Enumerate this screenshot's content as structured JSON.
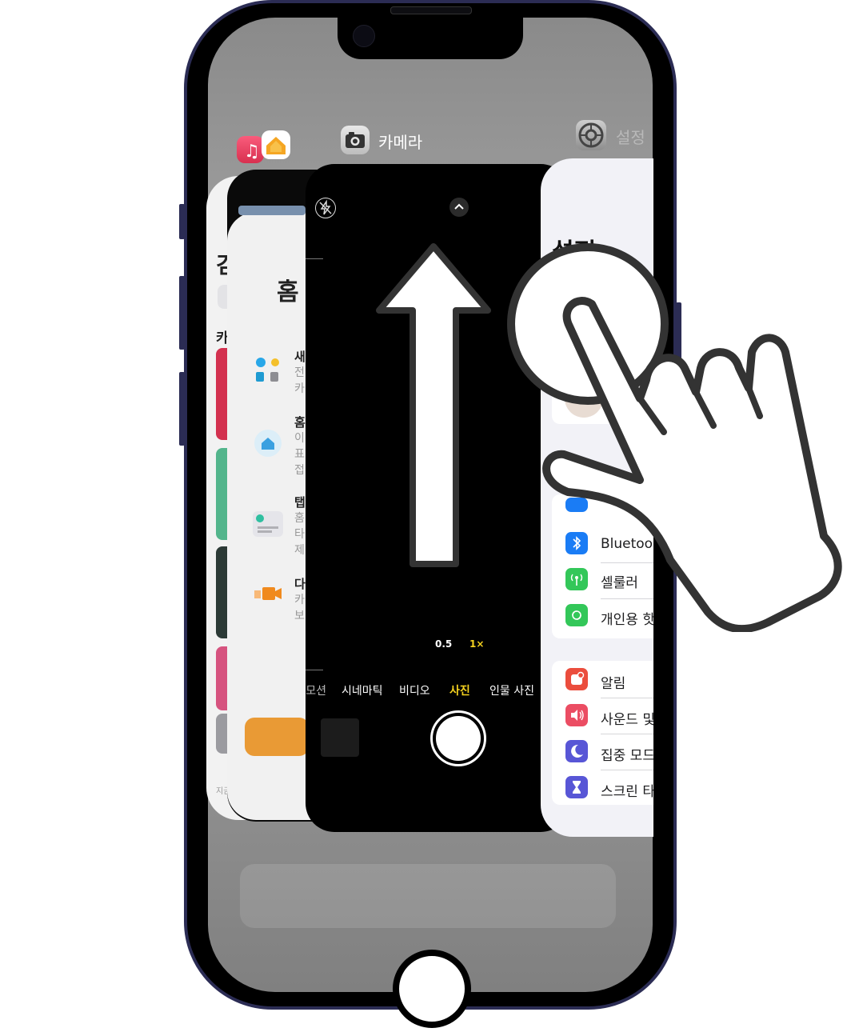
{
  "switcher": {
    "apps": [
      {
        "name": "music-home-stack",
        "label": ""
      },
      {
        "name": "camera",
        "label": "카메라"
      },
      {
        "name": "settings",
        "label": "설정"
      }
    ]
  },
  "home_card": {
    "title": "홈",
    "items": [
      {
        "title": "새",
        "lines": [
          "전",
          "카"
        ]
      },
      {
        "title": "홈",
        "lines": [
          "이",
          "표",
          "접"
        ]
      },
      {
        "title": "탭",
        "lines": [
          "홈",
          "타",
          "제"
        ]
      },
      {
        "title": "다",
        "lines": [
          "카",
          "보"
        ]
      }
    ]
  },
  "music_card": {
    "title": "검",
    "section": "카",
    "tab_label": "지금"
  },
  "camera": {
    "zoom_options": [
      "0.5",
      "1×"
    ],
    "modes": [
      "모션",
      "시네마틱",
      "비디오",
      "사진",
      "인물 사진"
    ],
    "selected_mode": "사진",
    "accent": "#f5d21f"
  },
  "settings_card": {
    "title": "설정",
    "group1": [
      {
        "icon": "bluetooth-icon",
        "label": "Bluetooth",
        "color": "#1a7cf5"
      },
      {
        "icon": "cellular-icon",
        "label": "셀룰러",
        "color": "#33c759"
      },
      {
        "icon": "hotspot-icon",
        "label": "개인용 핫스팟",
        "color": "#33c759"
      }
    ],
    "group2": [
      {
        "icon": "notifications-icon",
        "label": "알림",
        "color": "#eb4d3d"
      },
      {
        "icon": "sound-icon",
        "label": "사운드 및 햅틱",
        "color": "#eb4d63"
      },
      {
        "icon": "focus-icon",
        "label": "집중 모드",
        "color": "#5856d6"
      },
      {
        "icon": "screen-time-icon",
        "label": "스크린 타임",
        "color": "#5856d6"
      }
    ]
  },
  "gesture": {
    "instruction": "swipe-up-arrow"
  }
}
